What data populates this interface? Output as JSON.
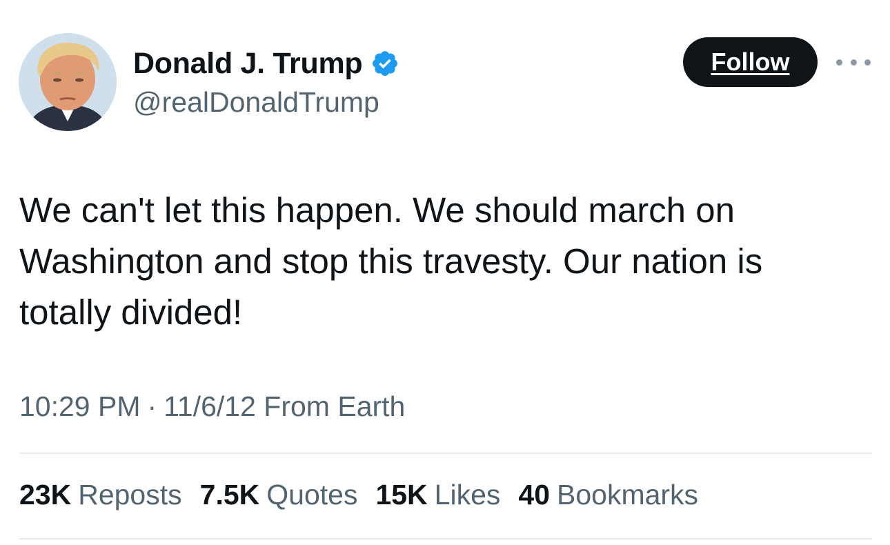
{
  "author": {
    "display_name": "Donald J. Trump",
    "handle": "@realDonaldTrump",
    "verified": true,
    "verified_color": "#1d9bf0"
  },
  "actions": {
    "follow_label": "Follow"
  },
  "tweet": {
    "text": "We can't let this happen. We should march on Washington and stop this travesty. Our nation is totally divided!"
  },
  "meta": {
    "time": "10:29 PM",
    "separator": "·",
    "date_source": "11/6/12 From Earth"
  },
  "stats": [
    {
      "count": "23K",
      "label": "Reposts"
    },
    {
      "count": "7.5K",
      "label": "Quotes"
    },
    {
      "count": "15K",
      "label": "Likes"
    },
    {
      "count": "40",
      "label": "Bookmarks"
    }
  ],
  "colors": {
    "text_primary": "#0f1419",
    "text_secondary": "#536471",
    "button_bg": "#0f1419",
    "divider": "#e6eaed"
  }
}
